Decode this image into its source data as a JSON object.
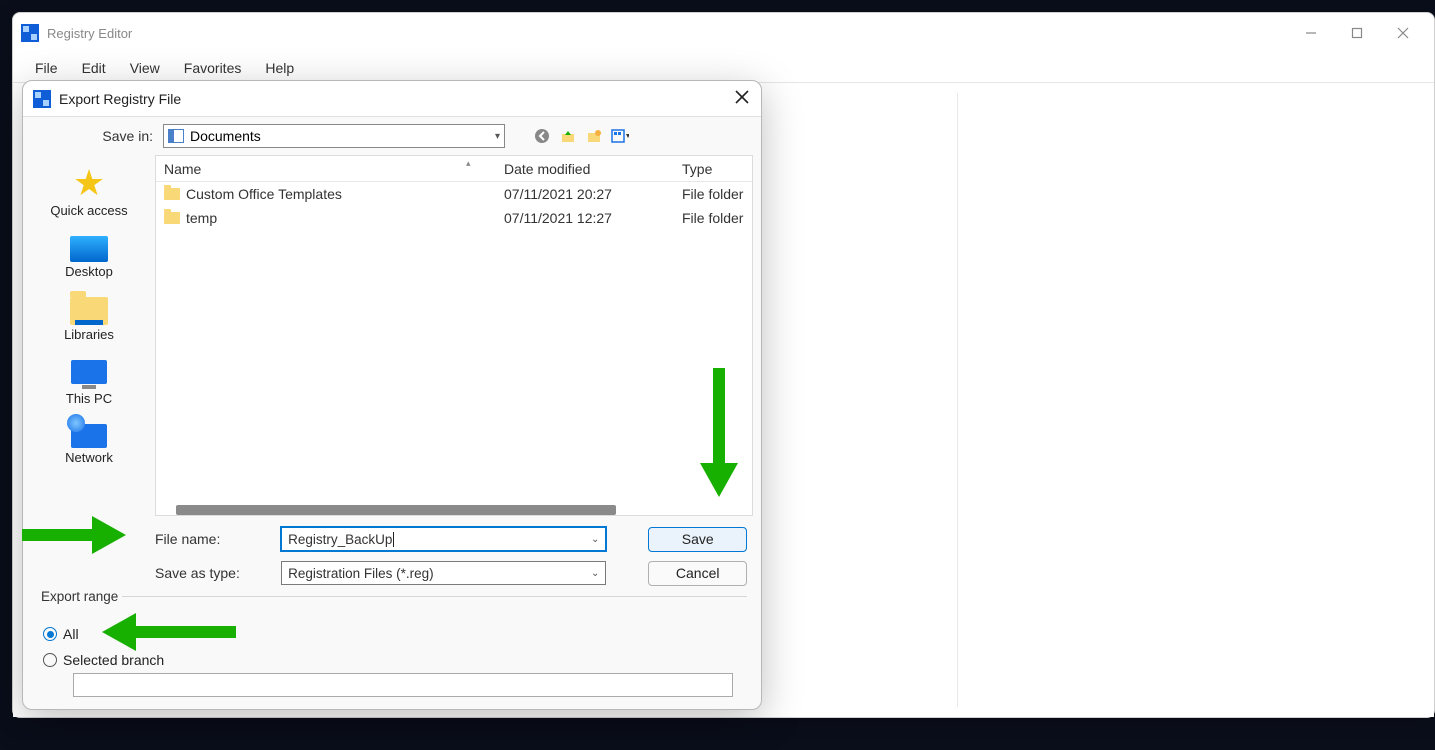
{
  "window": {
    "title": "Registry Editor",
    "menu": [
      "File",
      "Edit",
      "View",
      "Favorites",
      "Help"
    ]
  },
  "dialog": {
    "title": "Export Registry File",
    "save_in_label": "Save in:",
    "save_in_value": "Documents",
    "places": {
      "quick_access": "Quick access",
      "desktop": "Desktop",
      "libraries": "Libraries",
      "this_pc": "This PC",
      "network": "Network"
    },
    "columns": {
      "name": "Name",
      "date": "Date modified",
      "type": "Type"
    },
    "rows": [
      {
        "name": "Custom Office Templates",
        "date": "07/11/2021 20:27",
        "type": "File folder"
      },
      {
        "name": "temp",
        "date": "07/11/2021 12:27",
        "type": "File folder"
      }
    ],
    "filename_label": "File name:",
    "filename_value": "Registry_BackUp",
    "saveastype_label": "Save as type:",
    "saveastype_value": "Registration Files (*.reg)",
    "save_btn": "Save",
    "cancel_btn": "Cancel",
    "export_range_label": "Export range",
    "radio_all": "All",
    "radio_selected": "Selected branch"
  }
}
